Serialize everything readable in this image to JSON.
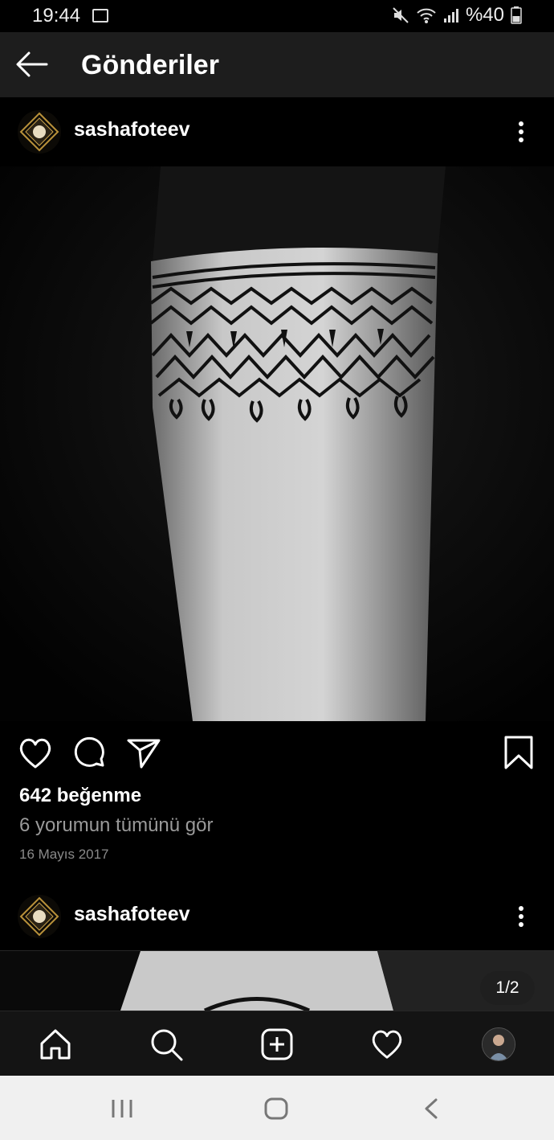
{
  "status_bar": {
    "time": "19:44",
    "battery": "%40"
  },
  "header": {
    "title": "Gönderiler"
  },
  "posts": [
    {
      "username": "sashafoteev",
      "likes": "642 beğenme",
      "comments_link": "6 yorumun tümünü gör",
      "date": "16 Mayıs 2017"
    },
    {
      "username": "sashafoteev",
      "page_indicator": "1/2"
    }
  ],
  "icons": {
    "back": "arrow-left-icon",
    "more": "more-vertical-icon",
    "like": "heart-icon",
    "comment": "comment-icon",
    "share": "send-icon",
    "save": "bookmark-icon",
    "nav": [
      "home-icon",
      "search-icon",
      "add-post-icon",
      "activity-heart-icon",
      "profile-avatar"
    ],
    "system_nav": [
      "recents-icon",
      "home-circle-icon",
      "back-chevron-icon"
    ]
  },
  "colors": {
    "background": "#000000",
    "header": "#1d1d1d",
    "secondary_text": "#9a9a9a"
  }
}
